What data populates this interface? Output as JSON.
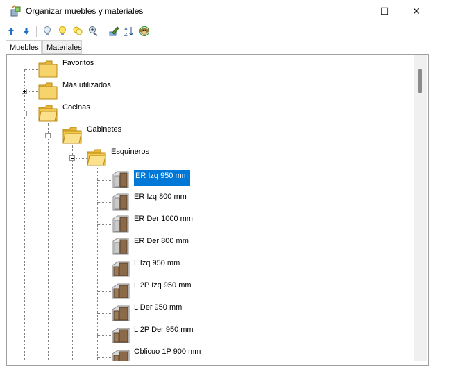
{
  "window": {
    "title": "Organizar muebles y materiales",
    "controls": {
      "minimize": "—",
      "maximize": "☐",
      "close": "✕"
    }
  },
  "toolbar": {
    "buttons": [
      "arrow-up-icon",
      "arrow-down-icon",
      "lightbulb-off-icon",
      "lightbulb-on-icon",
      "lightbulbs-icon",
      "eye-icon",
      "edit-icon",
      "sort-az-icon",
      "monkey-icon"
    ]
  },
  "tabs": [
    {
      "label": "Muebles",
      "active": true
    },
    {
      "label": "Materiales",
      "active": false
    }
  ],
  "tree": {
    "favoritos": "Favoritos",
    "mas_utilizados": "Más utilizados",
    "cocinas": "Cocinas",
    "gabinetes": "Gabinetes",
    "esquineros": "Esquineros",
    "items": [
      "ER Izq 950 mm",
      "ER Izq 800 mm",
      "ER Der 1000 mm",
      "ER Der 800 mm",
      "L Izq 950 mm",
      "L 2P Izq 950 mm",
      "L Der 950 mm",
      "L 2P Der 950 mm",
      "Oblicuo 1P 900 mm"
    ],
    "selected_index": 0
  },
  "colors": {
    "selection": "#0078d7",
    "folder": "#f2c94c"
  }
}
